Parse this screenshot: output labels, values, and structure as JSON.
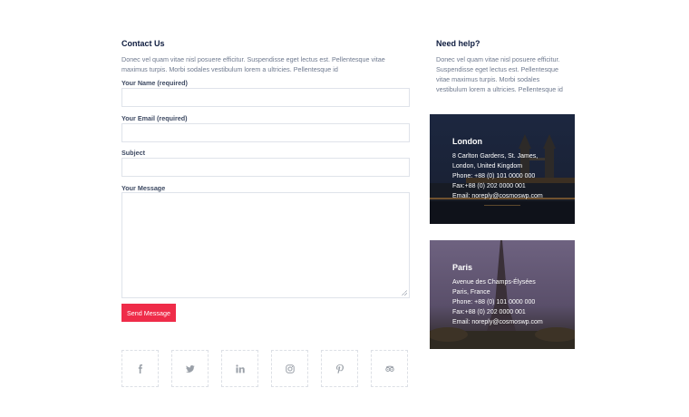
{
  "contact": {
    "title": "Contact Us",
    "description": "Donec vel quam vitae nisl posuere efficitur. Suspendisse eget lectus est. Pellentesque vitae maximus turpis. Morbi sodales vestibulum lorem a ultricies. Pellentesque id",
    "fields": {
      "name": {
        "label": "Your Name (required)",
        "value": "",
        "placeholder": ""
      },
      "email": {
        "label": "Your Email (required)",
        "value": "",
        "placeholder": ""
      },
      "subject": {
        "label": "Subject",
        "value": "",
        "placeholder": ""
      },
      "message": {
        "label": "Your Message",
        "value": "",
        "placeholder": ""
      }
    },
    "send_label": "Send Message"
  },
  "social": [
    {
      "icon": "facebook-icon"
    },
    {
      "icon": "twitter-icon"
    },
    {
      "icon": "linkedin-icon"
    },
    {
      "icon": "instagram-icon"
    },
    {
      "icon": "pinterest-icon"
    },
    {
      "icon": "tripadvisor-icon"
    }
  ],
  "help": {
    "title": "Need help?",
    "description": "Donec vel quam vitae nisl posuere efficitur. Suspendisse eget lectus est. Pellentesque vitae maximus turpis. Morbi sodales vestibulum lorem a ultricies. Pellentesque id"
  },
  "offices": [
    {
      "city": "London",
      "address_1": "8 Carlton Gardens, St. James,",
      "address_2": "London, United Kingdom",
      "phone": "Phone: +88 (0) 101 0000 000",
      "fax": "Fax:+88 (0) 202 0000 001",
      "email": "Email: noreply@cosmoswp.com"
    },
    {
      "city": "Paris",
      "address_1": "Avenue des Champs-Élysées",
      "address_2": "Paris, France",
      "phone": "Phone: +88 (0) 101 0000 000",
      "fax": "Fax:+88 (0) 202 0000 001",
      "email": "Email: noreply@cosmoswp.com"
    }
  ],
  "colors": {
    "title": "#0d1b3e",
    "button": "#ef2c49",
    "text": "#6f7a8f"
  }
}
